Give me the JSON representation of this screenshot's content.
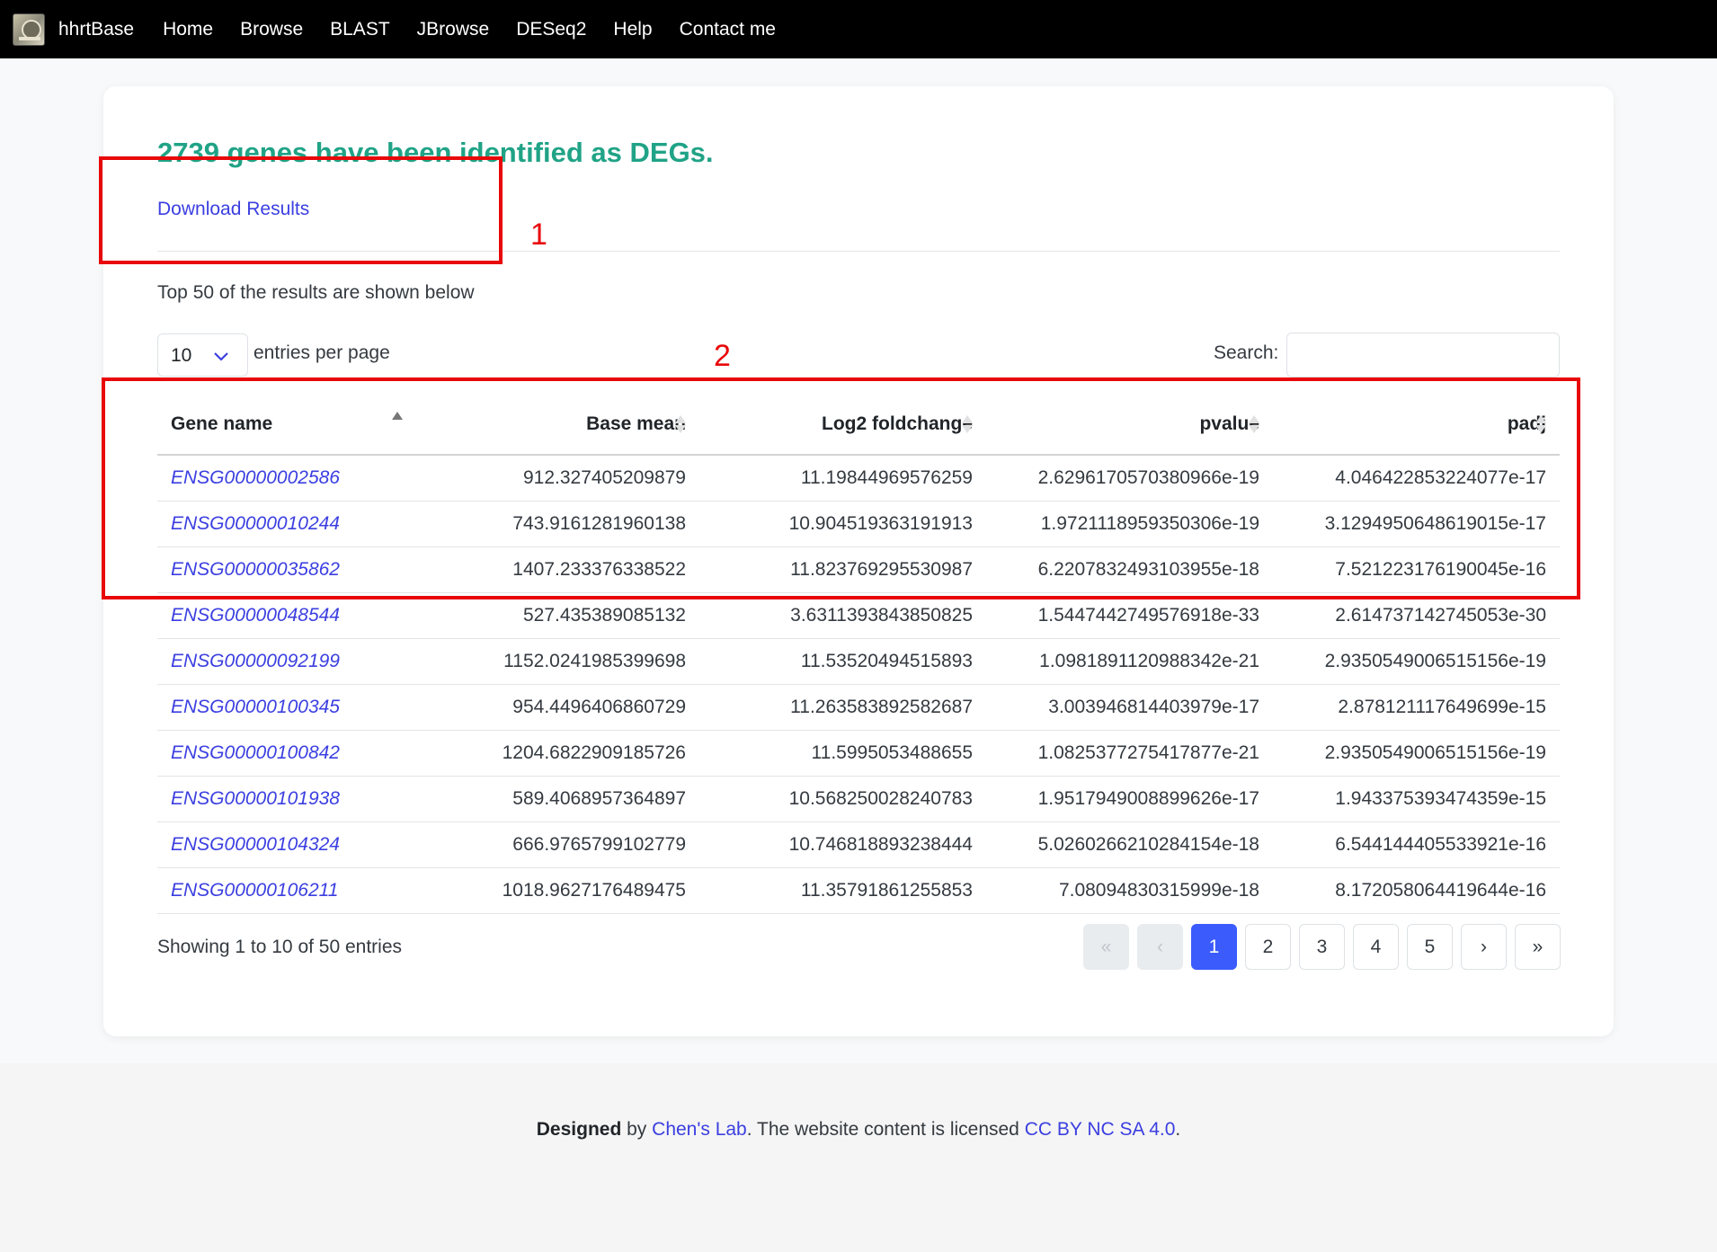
{
  "navbar": {
    "brand": "hhrtBase",
    "links": [
      "Home",
      "Browse",
      "BLAST",
      "JBrowse",
      "DESeq2",
      "Help",
      "Contact me"
    ]
  },
  "main": {
    "title": "2739 genes have been identified as DEGs.",
    "download_label": "Download Results",
    "top_note": "Top 50 of the results are shown below",
    "length_value": "10",
    "length_label": "entries per page",
    "search_label": "Search:",
    "search_value": ""
  },
  "table": {
    "columns": [
      "Gene name",
      "Base mean",
      "Log2 foldchange",
      "pvalue",
      "padj"
    ],
    "sorted_column": "Gene name",
    "sort_direction": "ascending",
    "rows": [
      [
        "ENSG00000002586",
        "912.327405209879",
        "11.19844969576259",
        "2.6296170570380966e-19",
        "4.046422853224077e-17"
      ],
      [
        "ENSG00000010244",
        "743.9161281960138",
        "10.904519363191913",
        "1.9721118959350306e-19",
        "3.1294950648619015e-17"
      ],
      [
        "ENSG00000035862",
        "1407.233376338522",
        "11.823769295530987",
        "6.2207832493103955e-18",
        "7.521223176190045e-16"
      ],
      [
        "ENSG00000048544",
        "527.435389085132",
        "3.6311393843850825",
        "1.5447442749576918e-33",
        "2.614737142745053e-30"
      ],
      [
        "ENSG00000092199",
        "1152.0241985399698",
        "11.53520494515893",
        "1.0981891120988342e-21",
        "2.9350549006515156e-19"
      ],
      [
        "ENSG00000100345",
        "954.4496406860729",
        "11.263583892582687",
        "3.003946814403979e-17",
        "2.878121117649699e-15"
      ],
      [
        "ENSG00000100842",
        "1204.6822909185726",
        "11.5995053488655",
        "1.0825377275417877e-21",
        "2.9350549006515156e-19"
      ],
      [
        "ENSG00000101938",
        "589.4068957364897",
        "10.568250028240783",
        "1.9517949008899626e-17",
        "1.943375393474359e-15"
      ],
      [
        "ENSG00000104324",
        "666.9765799102779",
        "10.746818893238444",
        "5.0260266210284154e-18",
        "6.544144405533921e-16"
      ],
      [
        "ENSG00000106211",
        "1018.9627176489475",
        "11.35791861255853",
        "7.08094830315999e-18",
        "8.172058064419644e-16"
      ]
    ]
  },
  "info": "Showing 1 to 10 of 50 entries",
  "pagination": {
    "first": "«",
    "prev": "‹",
    "pages": [
      "1",
      "2",
      "3",
      "4",
      "5"
    ],
    "active": "1",
    "next": "›",
    "last": "»"
  },
  "annotations": [
    "1",
    "2"
  ],
  "annotation_color": "#e8080a",
  "accent_color": "#20a386",
  "link_color": "#3b3fe0",
  "footer": {
    "designed": "Designed",
    "by": " by ",
    "lab": "Chen's Lab",
    "middle": ". The website content is licensed ",
    "license": "CC BY NC SA 4.0",
    "end": "."
  }
}
